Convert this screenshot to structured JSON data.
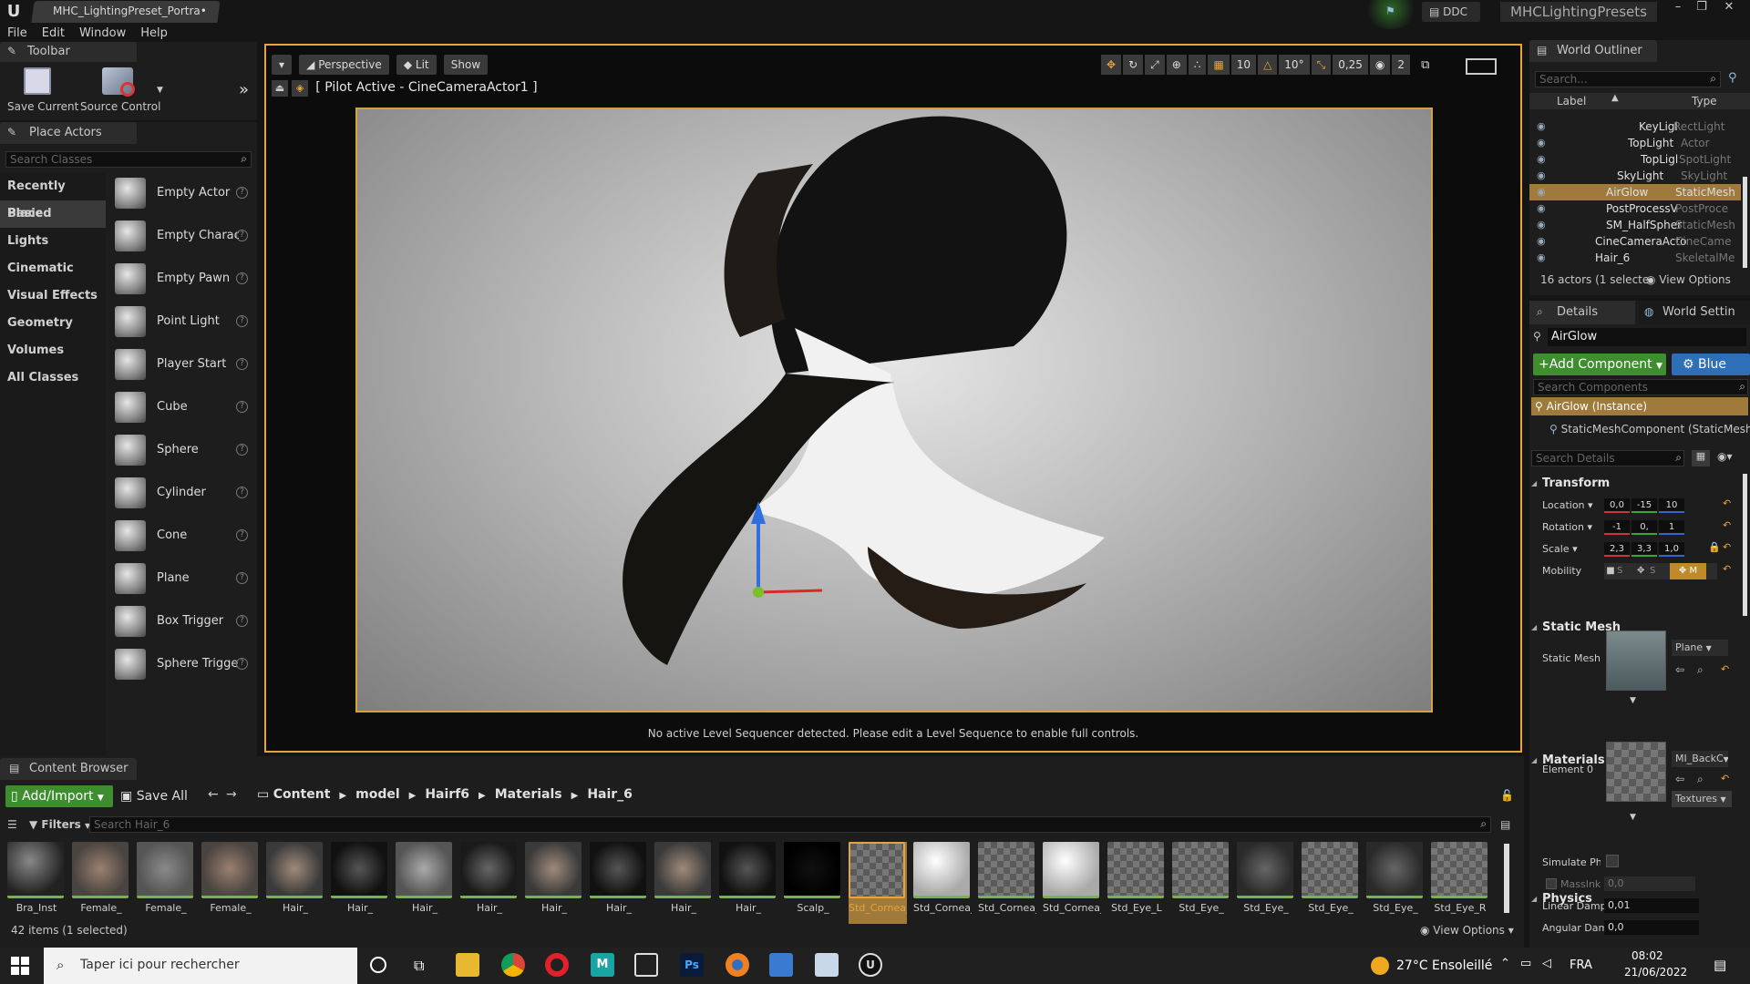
{
  "app": {
    "tab_title": "MHC_LightingPreset_Portra•",
    "project_name": "MHCLightingPresets",
    "ddc_label": "DDC",
    "menu": [
      "File",
      "Edit",
      "Window",
      "Help"
    ]
  },
  "toolbar": {
    "title": "Toolbar",
    "save_current": "Save Current",
    "source_control": "Source Control"
  },
  "place_actors": {
    "title": "Place Actors",
    "search_placeholder": "Search Classes",
    "categories": [
      "Recently Placed",
      "Basic",
      "Lights",
      "Cinematic",
      "Visual Effects",
      "Geometry",
      "Volumes",
      "All Classes"
    ],
    "selected_category": "Basic",
    "actors": [
      "Empty Actor",
      "Empty Charact",
      "Empty Pawn",
      "Point Light",
      "Player Start",
      "Cube",
      "Sphere",
      "Cylinder",
      "Cone",
      "Plane",
      "Box Trigger",
      "Sphere Trigger"
    ]
  },
  "viewport": {
    "perspective": "Perspective",
    "lit": "Lit",
    "show": "Show",
    "pilot_label": "[ Pilot Active - CineCameraActor1 ]",
    "grid_snap": "10",
    "rot_snap": "10°",
    "scale_snap": "0,25",
    "camera_speed": "2",
    "footer_msg": "No active Level Sequencer detected. Please edit a Level Sequence to enable full controls."
  },
  "outliner": {
    "title": "World Outliner",
    "search_placeholder": "Search...",
    "col_label": "Label",
    "col_type": "Type",
    "rows": [
      {
        "label": "KeyLigl",
        "type": "RectLight"
      },
      {
        "label": "TopLight",
        "type": "Actor"
      },
      {
        "label": "TopLigl",
        "type": "SpotLight"
      },
      {
        "label": "SkyLight",
        "type": "SkyLight"
      },
      {
        "label": "AirGlow",
        "type": "StaticMesh"
      },
      {
        "label": "PostProcessV",
        "type": "PostProce"
      },
      {
        "label": "SM_HalfSpher",
        "type": "StaticMesh"
      },
      {
        "label": "CineCameraActo",
        "type": "CineCame"
      },
      {
        "label": "Hair_6",
        "type": "SkeletalMe"
      }
    ],
    "selected": "AirGlow",
    "footer_count": "16 actors (1 selecte",
    "view_options": "View Options"
  },
  "details": {
    "tab_details": "Details",
    "tab_world": "World Settin",
    "object_name": "AirGlow",
    "add_component": "+Add Component",
    "blueprint": "Blue",
    "search_components": "Search Components",
    "instance_label": "AirGlow (Instance)",
    "component_label": "StaticMeshComponent (StaticMeshC",
    "search_details": "Search Details",
    "transform_section": "Transform",
    "location_label": "Location",
    "location": [
      "0,0",
      "-15",
      "10"
    ],
    "rotation_label": "Rotation",
    "rotation": [
      "-1",
      "0,",
      "1"
    ],
    "scale_label": "Scale",
    "scale": [
      "2,3",
      "3,3",
      "1,0"
    ],
    "mobility_label": "Mobility",
    "mobility_opts": [
      "S",
      "S",
      "M"
    ],
    "static_mesh_section": "Static Mesh",
    "static_mesh_label": "Static Mesh",
    "static_mesh_value": "Plane",
    "materials_section": "Materials",
    "element0_label": "Element 0",
    "element0_value": "MI_BackC",
    "textures_label": "Textures",
    "physics_section": "Physics",
    "simulate_label": "Simulate Ph",
    "massinkg_label": "MassInk",
    "massinkg_value": "0,0",
    "linear_damp_label": "Linear Damp",
    "linear_damp_value": "0,01",
    "angular_damp_label": "Angular Dam",
    "angular_damp_value": "0,0"
  },
  "content_browser": {
    "title": "Content Browser",
    "add_import": "Add/Import",
    "save_all": "Save All",
    "breadcrumb": [
      "Content",
      "model",
      "Hairf6",
      "Materials",
      "Hair_6"
    ],
    "filters": "Filters",
    "search_placeholder": "Search Hair_6",
    "assets": [
      "Bra_Inst",
      "Female_",
      "Female_",
      "Female_",
      "Hair_",
      "Hair_",
      "Hair_",
      "Hair_",
      "Hair_",
      "Hair_",
      "Hair_",
      "Hair_",
      "Scalp_",
      "Std_Cornea_L",
      "Std_Cornea_L",
      "Std_Cornea_R",
      "Std_Cornea_R",
      "Std_Eye_L",
      "Std_Eye_",
      "Std_Eye_",
      "Std_Eye_",
      "Std_Eye_",
      "Std_Eye_R"
    ],
    "selected_asset_index": 13,
    "footer_count": "42 items (1 selected)",
    "view_options": "View Options"
  },
  "taskbar": {
    "search_text": "Taper ici pour rechercher",
    "weather": "27°C Ensoleillé",
    "language": "FRA",
    "time": "08:02",
    "date": "21/06/2022"
  },
  "colors": {
    "accent_orange": "#e8a33a",
    "green_button": "#3e8d2e",
    "blue_button": "#2f6fb8",
    "selection": "#a07a3a"
  }
}
